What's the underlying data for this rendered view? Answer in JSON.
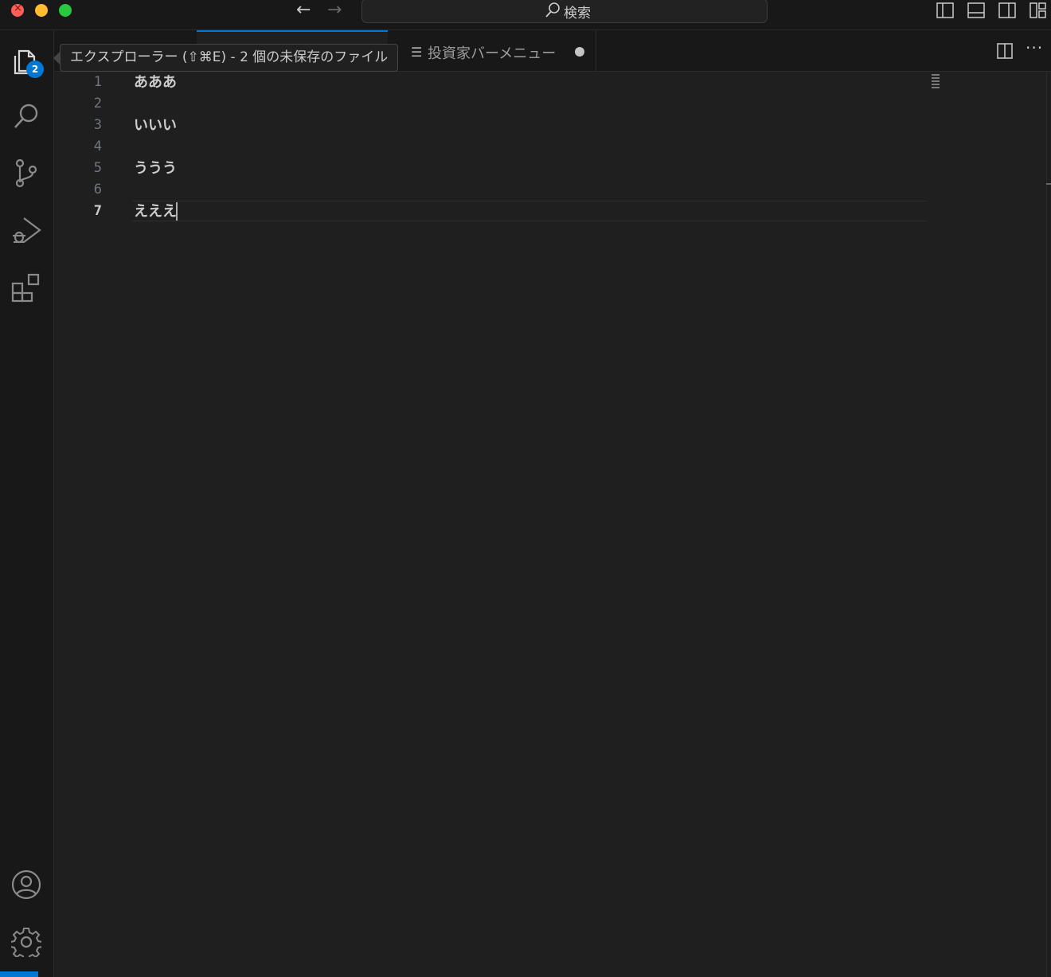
{
  "titlebar": {
    "search_label": "検索",
    "nav_back_icon": "arrow-left-icon",
    "nav_forward_icon": "arrow-right-icon",
    "layout_icons": [
      "toggle-primary-sidebar-icon",
      "toggle-panel-icon",
      "toggle-secondary-sidebar-icon",
      "customize-layout-icon"
    ]
  },
  "activity_bar": {
    "items": [
      {
        "name": "explorer",
        "icon": "files-icon",
        "badge": "2"
      },
      {
        "name": "search",
        "icon": "search-icon"
      },
      {
        "name": "source-control",
        "icon": "source-control-icon"
      },
      {
        "name": "run-debug",
        "icon": "run-debug-icon"
      },
      {
        "name": "extensions",
        "icon": "extensions-icon"
      }
    ],
    "bottom": [
      {
        "name": "accounts",
        "icon": "account-icon"
      },
      {
        "name": "manage",
        "icon": "gear-icon"
      }
    ]
  },
  "tooltip": {
    "text": "エクスプローラー (⇧⌘E) - 2 個の未保存のファイル"
  },
  "tabs": [
    {
      "label": "",
      "active": true
    },
    {
      "label": "投資家バーメニュー",
      "icon": "list-icon",
      "dirty": true,
      "active": false
    }
  ],
  "editor": {
    "lines": [
      {
        "number": "1",
        "text": "あああ"
      },
      {
        "number": "2",
        "text": ""
      },
      {
        "number": "3",
        "text": "いいい"
      },
      {
        "number": "4",
        "text": ""
      },
      {
        "number": "5",
        "text": "ううう"
      },
      {
        "number": "6",
        "text": ""
      },
      {
        "number": "7",
        "text": "えええ"
      }
    ],
    "current_line": "7"
  },
  "colors": {
    "accent": "#0078d4",
    "background": "#1f1f1f",
    "sidebar": "#181818"
  }
}
